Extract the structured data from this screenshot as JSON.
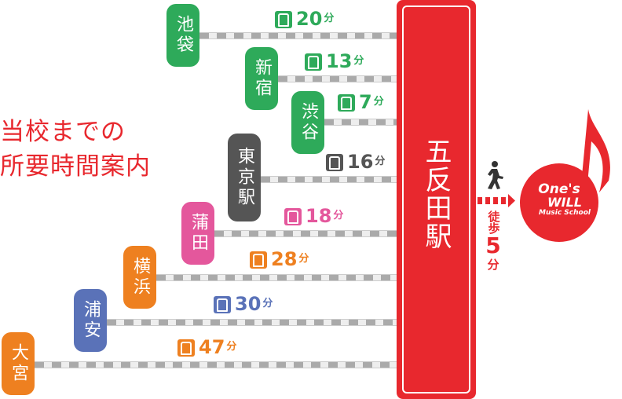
{
  "title_lines": [
    "当校までの",
    "所要時間案内"
  ],
  "destination": "五反田駅",
  "walk": {
    "label": "徒歩",
    "minutes": "5",
    "unit": "分",
    "icon": "walking-person-icon"
  },
  "logo": {
    "line1": "One's",
    "line2": "WILL",
    "line3": "Music School"
  },
  "unit": "分",
  "colors": {
    "red": "#e8282e",
    "green": "#2eaa5a",
    "gray": "#555555",
    "pink": "#e4579c",
    "orange": "#ee8020",
    "blue": "#5a72b8"
  },
  "stations": [
    {
      "name": "池袋",
      "minutes": "20",
      "color": "#2eaa5a"
    },
    {
      "name": "新宿",
      "minutes": "13",
      "color": "#2eaa5a"
    },
    {
      "name": "渋谷",
      "minutes": "7",
      "color": "#2eaa5a"
    },
    {
      "name": "東京駅",
      "minutes": "16",
      "color": "#555555"
    },
    {
      "name": "蒲田",
      "minutes": "18",
      "color": "#e4579c"
    },
    {
      "name": "横浜",
      "minutes": "28",
      "color": "#ee8020"
    },
    {
      "name": "浦安",
      "minutes": "30",
      "color": "#5a72b8"
    },
    {
      "name": "大宮",
      "minutes": "47",
      "color": "#ee8020"
    }
  ]
}
